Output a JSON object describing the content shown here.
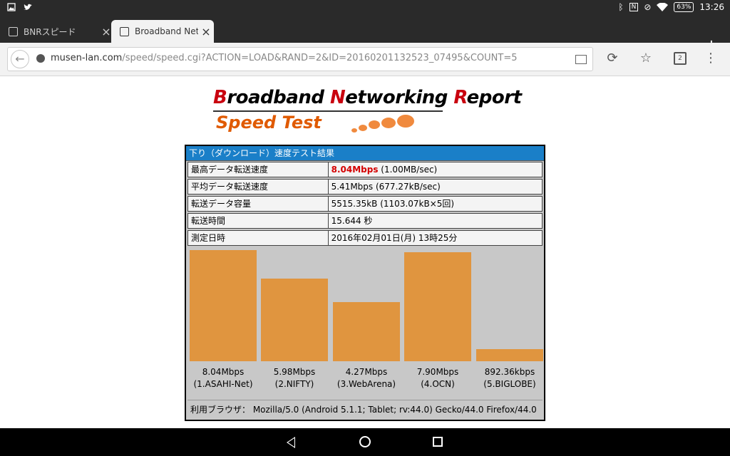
{
  "status_bar": {
    "time": "13:26",
    "battery": "63%"
  },
  "tabs": [
    {
      "title": "BNRスピード",
      "active": false
    },
    {
      "title": "Broadband Netw",
      "active": true
    }
  ],
  "address_bar": {
    "domain": "musen-lan.com",
    "path": "/speed/speed.cgi?ACTION=LOAD&RAND=2&ID=20160201132523_07495&COUNT=5"
  },
  "toolbar": {
    "tab_count": "2"
  },
  "logo": {
    "line1": [
      "B",
      "roadband ",
      "N",
      "etworking ",
      "R",
      "eport"
    ],
    "line2": "Speed Test"
  },
  "result": {
    "heading": "下り（ダウンロード）速度テスト結果",
    "rows": [
      {
        "label": "最高データ転送速度",
        "value_highlight": "8.04Mbps",
        "value": " (1.00MB/sec)"
      },
      {
        "label": "平均データ転送速度",
        "value": "5.41Mbps (677.27kB/sec)"
      },
      {
        "label": "転送データ容量",
        "value": "5515.35kB (1103.07kB×5回)"
      },
      {
        "label": "転送時間",
        "value": "15.644 秒"
      },
      {
        "label": "測定日時",
        "value": "2016年02月01日(月) 13時25分"
      }
    ],
    "footer": "利用ブラウザ： Mozilla/5.0 (Android 5.1.1; Tablet; rv:44.0) Gecko/44.0 Firefox/44.0"
  },
  "chart_data": {
    "type": "bar",
    "categories": [
      "(1.ASAHI-Net)",
      "(2.NIFTY)",
      "(3.WebArena)",
      "(4.OCN)",
      "(5.BIGLOBE)"
    ],
    "values": [
      8.04,
      5.98,
      4.27,
      7.9,
      0.89236
    ],
    "value_labels": [
      "8.04Mbps",
      "5.98Mbps",
      "4.27Mbps",
      "7.90Mbps",
      "892.36kbps"
    ],
    "unit": "Mbps",
    "color": "#e0953f",
    "ylim": [
      0,
      8.04
    ]
  }
}
